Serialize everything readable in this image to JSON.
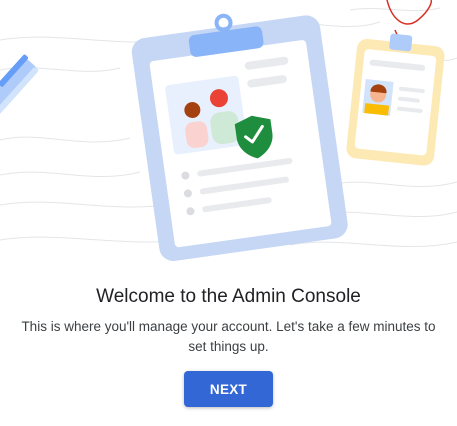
{
  "welcome": {
    "title": "Welcome to the Admin Console",
    "description": "This is where you'll manage your account. Let's take a few minutes to set things up.",
    "next_label": "NEXT"
  },
  "illustration": {
    "items": [
      "pen-icon",
      "clipboard-icon",
      "id-badge-icon",
      "shield-check-icon"
    ]
  },
  "colors": {
    "accent": "#3367d6",
    "clipboard_blue": "#c6d7f5",
    "badge_yellow": "#fde9b3",
    "check_green": "#1e8e3e",
    "lanyard_red": "#d93025"
  }
}
